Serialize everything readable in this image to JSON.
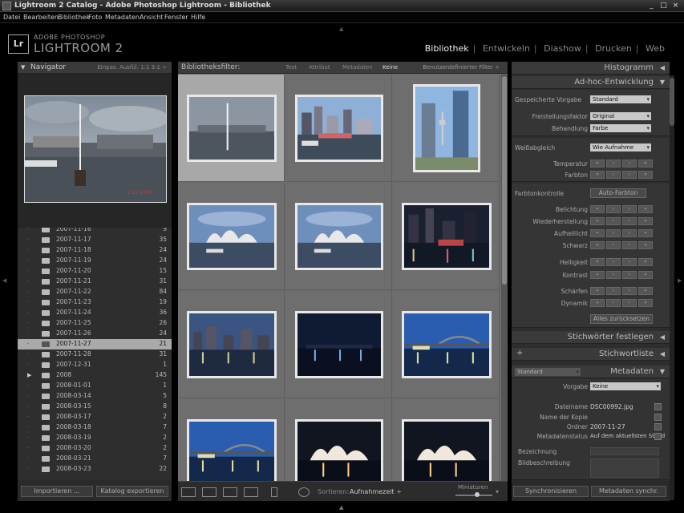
{
  "window": {
    "title": "Lightroom 2 Catalog - Adobe Photoshop Lightroom - Bibliothek"
  },
  "menu": [
    "Datei",
    "Bearbeiten",
    "Bibliothek",
    "Foto",
    "Metadaten",
    "Ansicht",
    "Fenster",
    "Hilfe"
  ],
  "brand": {
    "logo": "Lr",
    "top": "ADOBE PHOTOSHOP",
    "main": "LIGHTROOM 2"
  },
  "modules": [
    "Bibliothek",
    "Entwickeln",
    "Diashow",
    "Drucken",
    "Web"
  ],
  "active_module": "Bibliothek",
  "navigator": {
    "title": "Navigator",
    "options": "Einpas.   Ausfül.   1:1   3:1 ÷"
  },
  "folders": [
    {
      "name": "2007-11-16",
      "count": "9"
    },
    {
      "name": "2007-11-17",
      "count": "35"
    },
    {
      "name": "2007-11-18",
      "count": "24"
    },
    {
      "name": "2007-11-19",
      "count": "24"
    },
    {
      "name": "2007-11-20",
      "count": "15"
    },
    {
      "name": "2007-11-21",
      "count": "31"
    },
    {
      "name": "2007-11-22",
      "count": "84"
    },
    {
      "name": "2007-11-23",
      "count": "19"
    },
    {
      "name": "2007-11-24",
      "count": "36"
    },
    {
      "name": "2007-11-25",
      "count": "26"
    },
    {
      "name": "2007-11-26",
      "count": "24"
    },
    {
      "name": "2007-11-27",
      "count": "21",
      "selected": true
    },
    {
      "name": "2007-11-28",
      "count": "31"
    },
    {
      "name": "2007-12-31",
      "count": "1"
    },
    {
      "name": "2008",
      "count": "145",
      "open": true
    },
    {
      "name": "2008-01-01",
      "count": "1"
    },
    {
      "name": "2008-03-14",
      "count": "5"
    },
    {
      "name": "2008-03-15",
      "count": "8"
    },
    {
      "name": "2008-03-17",
      "count": "2"
    },
    {
      "name": "2008-03-18",
      "count": "7"
    },
    {
      "name": "2008-03-19",
      "count": "2"
    },
    {
      "name": "2008-03-20",
      "count": "2"
    },
    {
      "name": "2008-03-21",
      "count": "7"
    },
    {
      "name": "2008-03-23",
      "count": "22"
    }
  ],
  "left_buttons": {
    "import": "Importieren ...",
    "export": "Katalog exportieren"
  },
  "filter": {
    "title": "Bibliotheksfilter:",
    "tabs": [
      "Text",
      "Attribut",
      "Metadaten",
      "Keine"
    ],
    "active_tab": "Keine",
    "preset": "Benutzerdefinierter Filter ÷"
  },
  "toolbar": {
    "sort_label": "Sortieren:",
    "sort_value": "Aufnahmezeit ÷",
    "thumbs_label": "Miniaturen"
  },
  "right": {
    "histogram": "Histogramm",
    "quick_develop": "Ad-hoc-Entwicklung",
    "saved_preset_label": "Gespeicherte Vorgabe",
    "saved_preset_value": "Standard",
    "crop_label": "Freistellungsfaktor",
    "crop_value": "Original",
    "treatment_label": "Behandlung",
    "treatment_value": "Farbe",
    "wb_label": "Weißabgleich",
    "wb_value": "Wie Aufnahme",
    "temp_label": "Temperatur",
    "tint_label": "Farbton",
    "tone_label": "Farbtonkontrolle",
    "auto_tone": "Auto-Farbton",
    "exposure_label": "Belichtung",
    "recovery_label": "Wiederherstellung",
    "fill_label": "Aufhelllicht",
    "blacks_label": "Schwarz",
    "brightness_label": "Helligkeit",
    "contrast_label": "Kontrast",
    "clarity_label": "Schärfen",
    "vibrance_label": "Dynamik",
    "reset_all": "Alles zurücksetzen",
    "keywording": "Stichwörter festlegen",
    "keyword_list": "Stichwortliste",
    "metadata": "Metadaten",
    "metadata_set": "Standard",
    "preset_label": "Vorgabe",
    "preset_value": "Keine",
    "filename_label": "Dateiname",
    "filename_value": "DSC00992.jpg",
    "copyname_label": "Name der Kopie",
    "folder_label": "Ordner",
    "folder_value": "2007-11-27",
    "metastatus_label": "Metadatenstatus",
    "metastatus_value": "Auf dem aktuellsten Stand",
    "title_label": "Bezeichnung",
    "caption_label": "Bildbeschreibung",
    "sync_btn": "Synchronisieren",
    "sync_meta_btn": "Metadaten synchr."
  },
  "colors": {
    "accent_selected": "#a8a8a8",
    "panel": "#2e2e2e",
    "grid_bg": "#6b6b6b"
  }
}
